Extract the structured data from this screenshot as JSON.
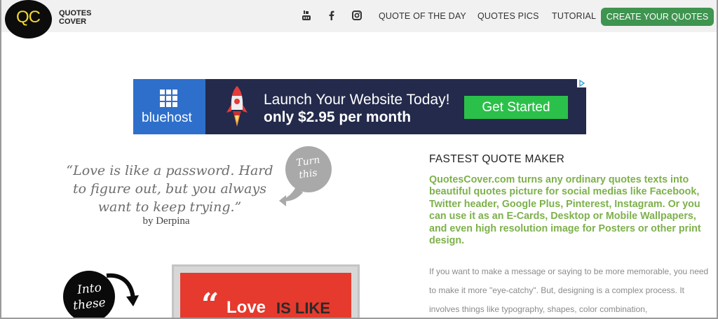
{
  "header": {
    "logo_initials": "QC",
    "logo_line1": "QUOTES",
    "logo_line2": "COVER",
    "social": [
      "youtube-icon",
      "facebook-icon",
      "instagram-icon"
    ],
    "nav": [
      "QUOTE OF THE DAY",
      "QUOTES PICS",
      "TUTORIAL"
    ],
    "cta": "CREATE YOUR QUOTES"
  },
  "ad": {
    "brand": "bluehost",
    "line1": "Launch Your Website Today!",
    "line2": "only $2.95 per month",
    "cta": "Get Started",
    "colors": {
      "brand_bg": "#2e6fcb",
      "bg": "#232a4b",
      "cta_bg": "#2bc04a"
    }
  },
  "example": {
    "quote": "“Love is like a password. Hard to figure out, but you always want to keep trying.”",
    "author": "by Derpina",
    "bubble1": [
      "Turn",
      "this"
    ],
    "bubble2": [
      "Into",
      "these"
    ],
    "poster_words": [
      "Love",
      "IS LIKE"
    ]
  },
  "content": {
    "title": "FASTEST QUOTE MAKER",
    "highlight": "QuotesCover.com turns any ordinary quotes texts into beautiful quotes picture for social medias like Facebook, Twitter header, Google Plus, Pinterest, Instagram. Or you can use it as an E-Cards, Desktop or Mobile Wallpapers, and even high resolution image for Posters or other print design.",
    "body": "If you want to make a message or saying to be more memorable, you need to make it more \"eye-catchy\". But, designing is a complex process. It involves things like typography, shapes, color combination,",
    "accent_green": "#7db14b",
    "button_green": "#3f9450"
  }
}
